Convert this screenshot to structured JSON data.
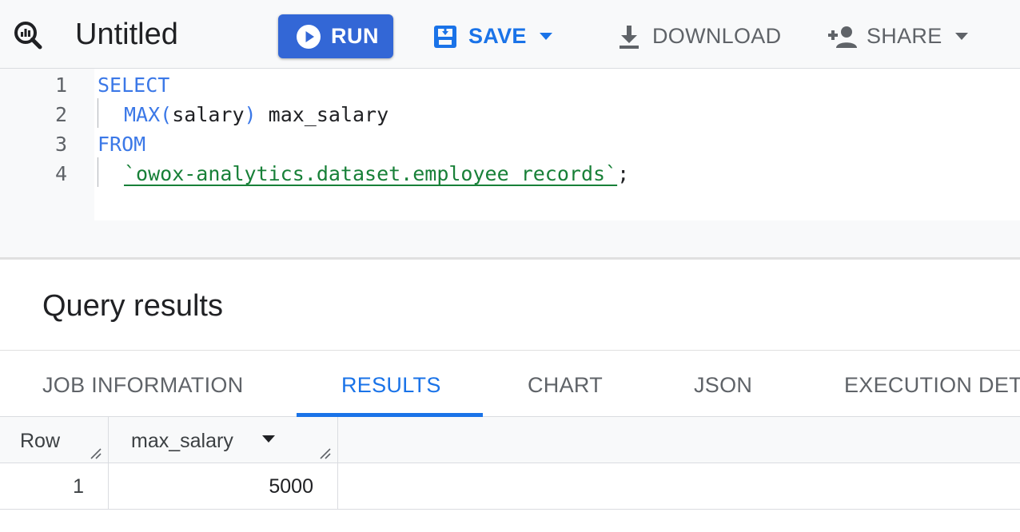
{
  "toolbar": {
    "title": "Untitled",
    "run_label": "RUN",
    "save_label": "SAVE",
    "download_label": "DOWNLOAD",
    "share_label": "SHARE",
    "accent_color": "#1a73e8",
    "run_button_color": "#3367d6"
  },
  "editor": {
    "lines": [
      {
        "number": "1",
        "tokens": [
          "SELECT"
        ]
      },
      {
        "number": "2",
        "tokens": [
          "MAX(",
          "salary",
          ")",
          " max_salary"
        ]
      },
      {
        "number": "3",
        "tokens": [
          "FROM"
        ]
      },
      {
        "number": "4",
        "tokens": [
          "`owox-analytics.dataset.employee_records`",
          ";"
        ]
      }
    ]
  },
  "results": {
    "title": "Query results",
    "tabs": [
      {
        "label": "JOB INFORMATION",
        "active": false
      },
      {
        "label": "RESULTS",
        "active": true
      },
      {
        "label": "CHART",
        "active": false
      },
      {
        "label": "JSON",
        "active": false
      },
      {
        "label": "EXECUTION DET",
        "active": false
      }
    ],
    "columns": [
      "Row",
      "max_salary"
    ],
    "rows": [
      {
        "row": "1",
        "max_salary": "5000"
      }
    ]
  },
  "icons": {
    "query": "query-magnifier-icon",
    "run": "play-circle-icon",
    "save": "save-icon",
    "download": "download-icon",
    "share": "person-add-icon",
    "dropdown": "caret-down-icon"
  }
}
